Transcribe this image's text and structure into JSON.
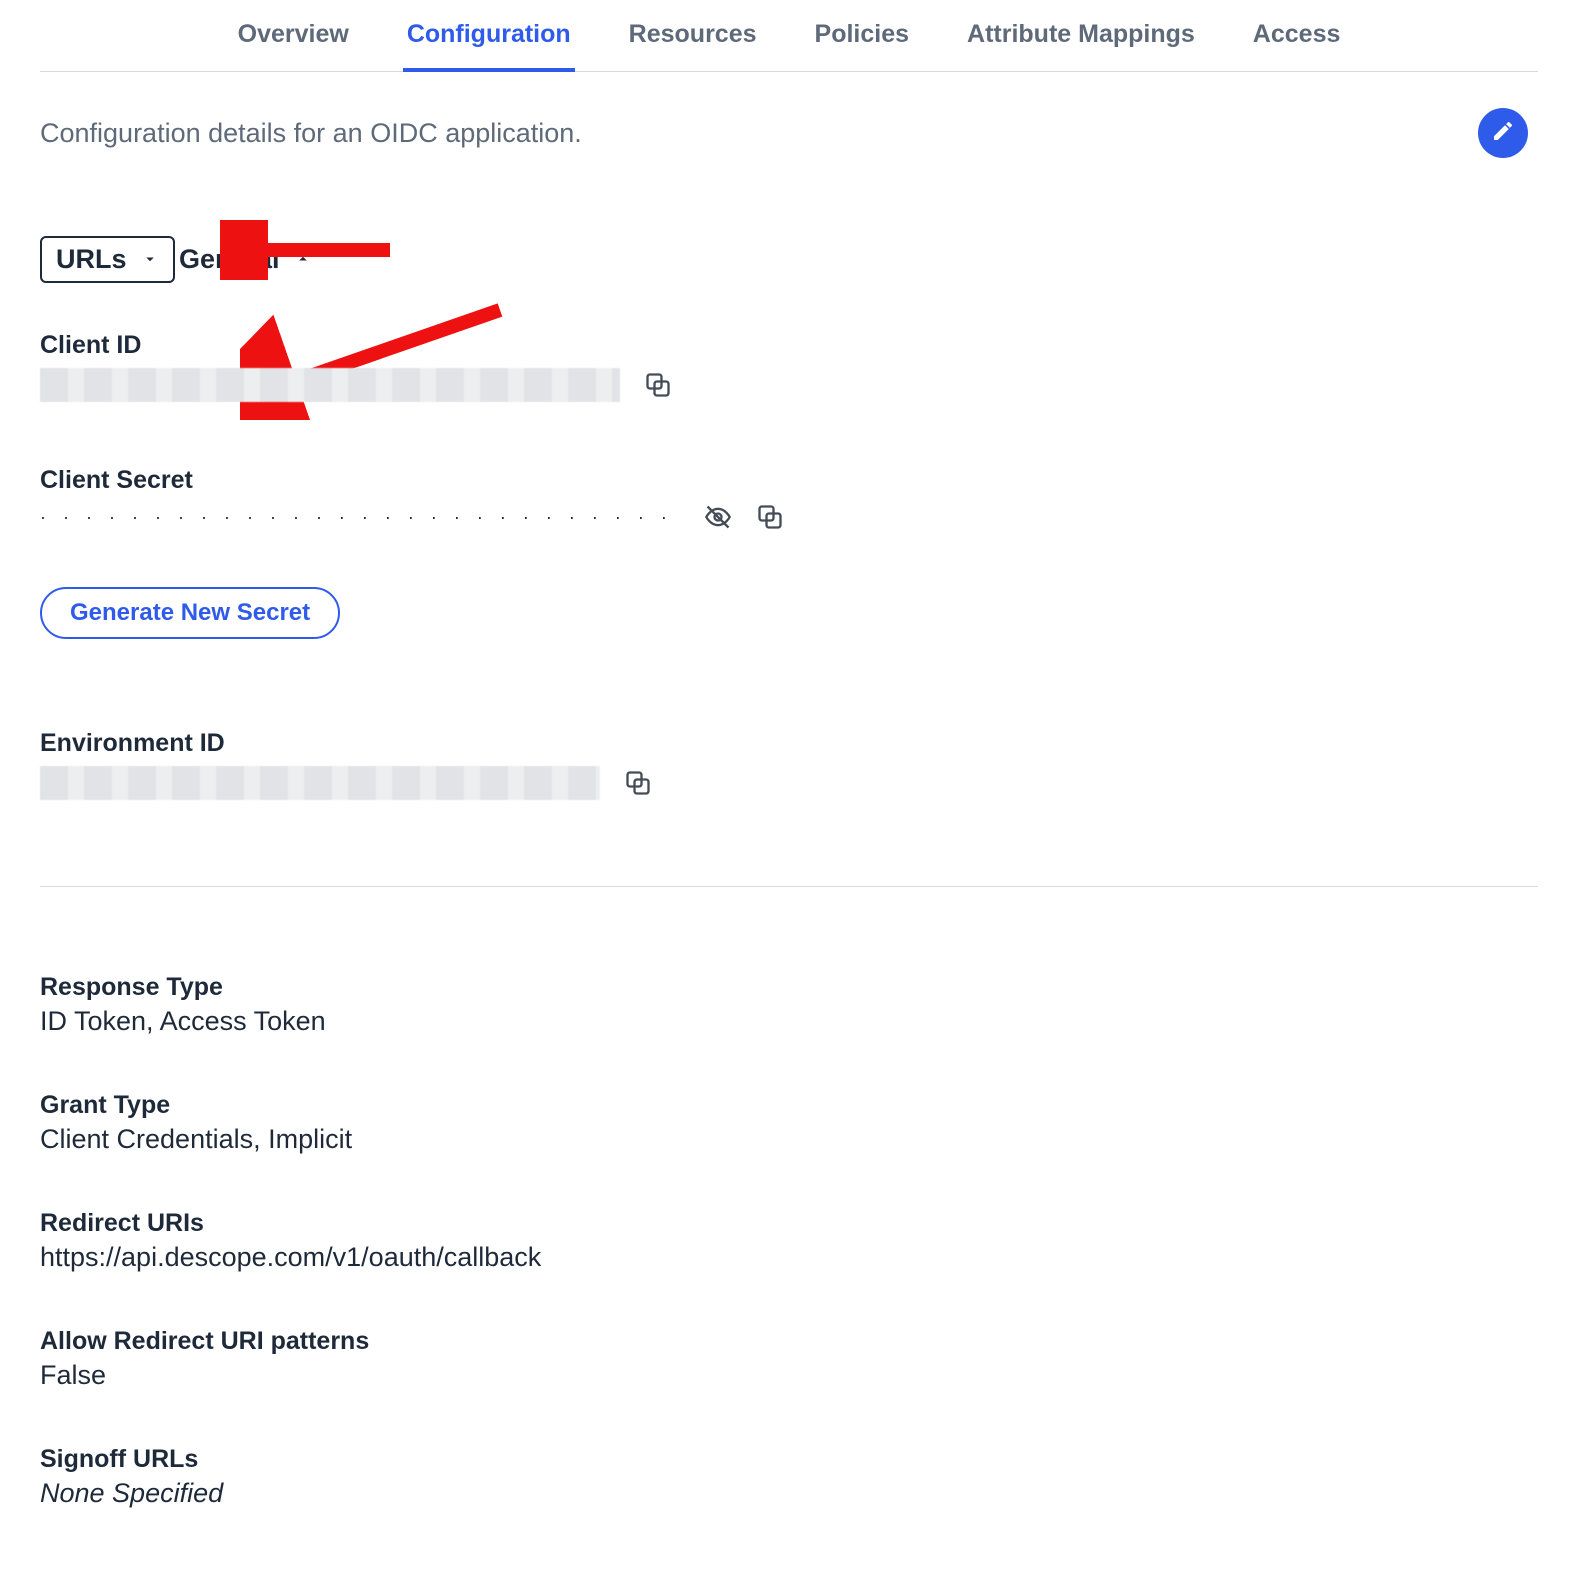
{
  "tabs": {
    "overview": "Overview",
    "configuration": "Configuration",
    "resources": "Resources",
    "policies": "Policies",
    "attribute_mappings": "Attribute Mappings",
    "access": "Access"
  },
  "description": "Configuration details for an OIDC application.",
  "urls_dropdown_label": "URLs",
  "section_general": "General",
  "fields": {
    "client_id_label": "Client ID",
    "client_secret_label": "Client Secret",
    "client_secret_masked": "· · · · · · · · · · · · · · · · · · · · · · · · · · · · · · · · · · · · · · · · · · · · · · · · · · · · · · · · · · · · · · · · · · · · · · · · · · · ·",
    "generate_new_secret": "Generate New Secret",
    "environment_id_label": "Environment ID"
  },
  "details": {
    "response_type_label": "Response Type",
    "response_type_value": "ID Token, Access Token",
    "grant_type_label": "Grant Type",
    "grant_type_value": "Client Credentials, Implicit",
    "redirect_uris_label": "Redirect URIs",
    "redirect_uris_value": "https://api.descope.com/v1/oauth/callback",
    "allow_redirect_label": "Allow Redirect URI patterns",
    "allow_redirect_value": "False",
    "signoff_urls_label": "Signoff URLs",
    "signoff_urls_value": "None Specified"
  }
}
